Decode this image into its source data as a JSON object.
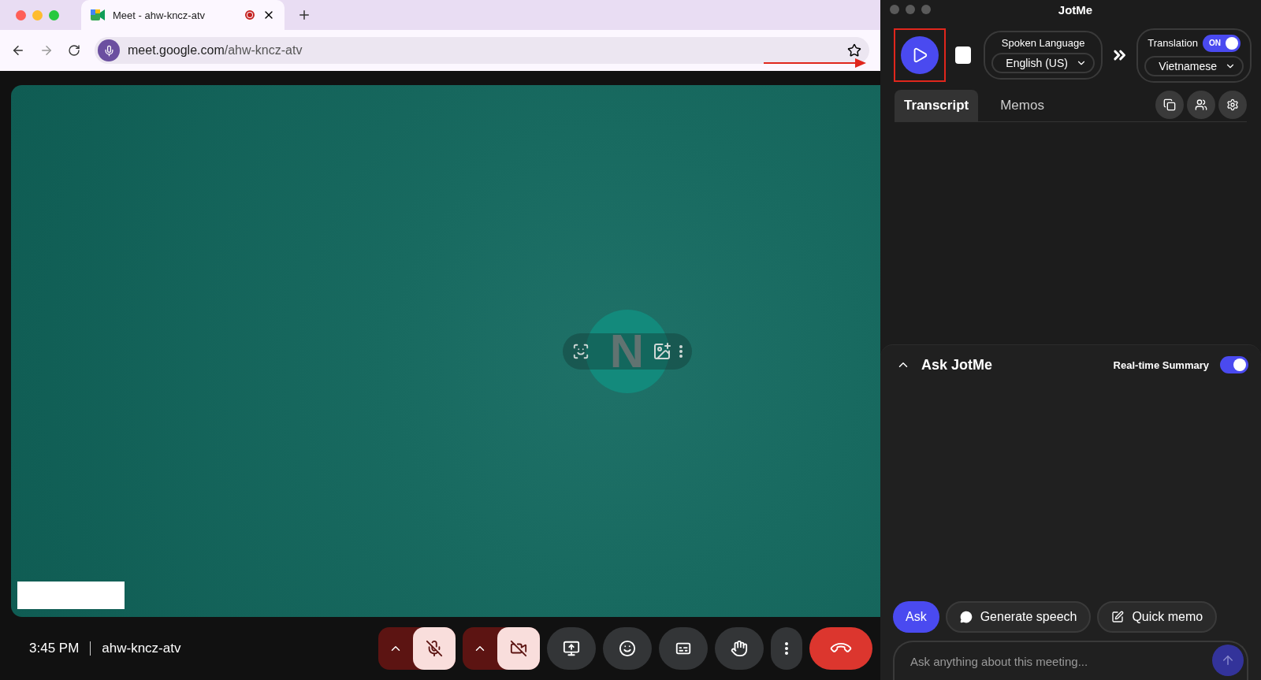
{
  "browser": {
    "tab": {
      "title": "Meet - ahw-kncz-atv",
      "recording": true
    },
    "address": {
      "host": "meet.google.com",
      "path": "/ahw-kncz-atv"
    }
  },
  "meeting": {
    "avatar_initial": "N",
    "time": "3:45 PM",
    "code": "ahw-kncz-atv",
    "controls": [
      {
        "kind": "mic",
        "muted": true
      },
      {
        "kind": "camera",
        "muted": true
      },
      {
        "kind": "present"
      },
      {
        "kind": "emoji"
      },
      {
        "kind": "captions"
      },
      {
        "kind": "hand"
      },
      {
        "kind": "more"
      },
      {
        "kind": "leave"
      }
    ]
  },
  "jotme": {
    "title": "JotMe",
    "recording": false,
    "spoken_language": {
      "label": "Spoken Language",
      "value": "English (US)"
    },
    "translation": {
      "label": "Translation",
      "toggle_text": "ON",
      "on": true,
      "value": "Vietnamese"
    },
    "tabs": [
      {
        "label": "Transcript",
        "selected": true
      },
      {
        "label": "Memos",
        "selected": false
      }
    ],
    "ask": {
      "title": "Ask JotMe",
      "expanded": true,
      "summary": {
        "label": "Real-time Summary",
        "on": true
      },
      "actions": [
        {
          "kind": "primary",
          "label": "Ask"
        },
        {
          "kind": "speech",
          "label": "Generate speech"
        },
        {
          "kind": "memo",
          "label": "Quick memo"
        }
      ],
      "placeholder": "Ask anything about this meeting..."
    }
  }
}
